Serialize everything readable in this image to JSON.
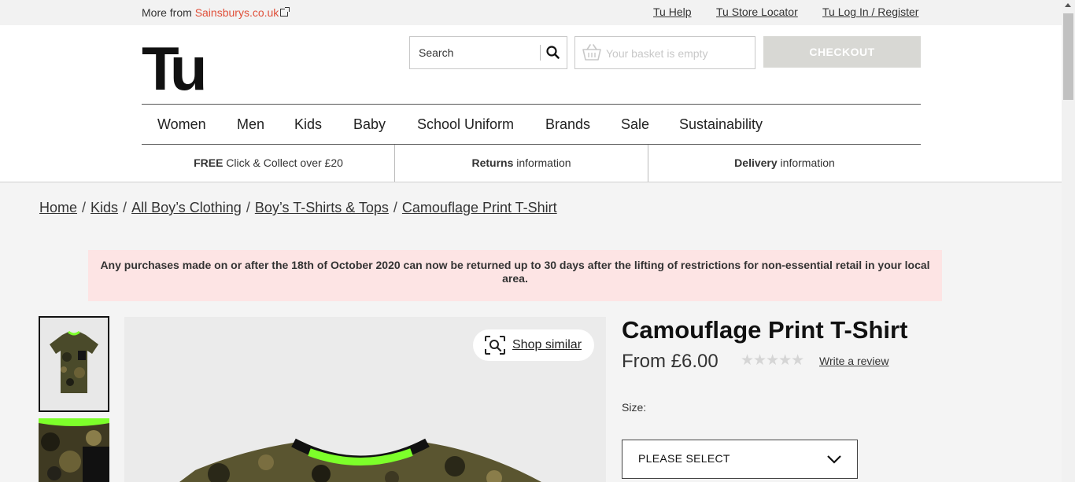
{
  "utility": {
    "more_from_prefix": "More from ",
    "more_from_brand": "Sainsburys.co.uk",
    "links": [
      "Tu Help",
      "Tu Store Locator",
      "Tu Log In / Register"
    ]
  },
  "header": {
    "logo": "Tu",
    "search_placeholder": "Search",
    "basket_text": "Your basket is empty",
    "checkout_label": "CHECKOUT"
  },
  "nav": {
    "items": [
      "Women",
      "Men",
      "Kids",
      "Baby",
      "School Uniform",
      "Brands",
      "Sale",
      "Sustainability"
    ]
  },
  "promos": [
    {
      "bold": "FREE",
      "rest": " Click & Collect over £20"
    },
    {
      "bold": "Returns",
      "rest": " information"
    },
    {
      "bold": "Delivery",
      "rest": " information"
    }
  ],
  "breadcrumb": [
    "Home",
    "Kids",
    "All Boy’s Clothing",
    "Boy’s T-Shirts & Tops",
    "Camouflage Print T-Shirt"
  ],
  "notice": "Any purchases made on or after the 18th of October 2020 can now be returned up to 30 days after the lifting of restrictions for non-essential retail in your local area.",
  "product": {
    "title": "Camouflage Print T-Shirt",
    "price": "From £6.00",
    "rating_stars": "★★★★★",
    "rating": 0,
    "review_link": "Write a review",
    "shop_similar": "Shop similar",
    "size_label": "Size:",
    "size_value": "PLEASE SELECT"
  },
  "colors": {
    "brand_link": "#e0503a",
    "notice_bg": "#fde4e4",
    "checkout_disabled": "#d8d8d4",
    "neon_trim": "#7dff2a"
  }
}
